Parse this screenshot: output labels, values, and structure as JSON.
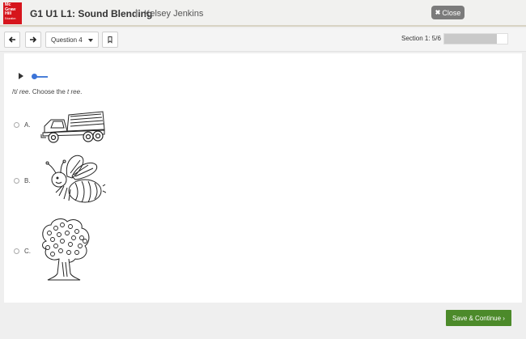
{
  "header": {
    "logo_lines": [
      "Mc",
      "Graw",
      "Hill",
      "Education"
    ],
    "title": "G1 U1 L1: Sound Blending",
    "separator": "|",
    "user_name": "Kelsey Jenkins",
    "close_label": "Close"
  },
  "toolbar": {
    "question_select": "Question 4",
    "section_label": "Section 1: 5/6",
    "progress_fraction": 0.83
  },
  "question": {
    "prompt_parts": [
      "/t/ ",
      "ree",
      ". Choose the ",
      "t ree",
      "."
    ],
    "options": [
      {
        "letter": "A.",
        "image": "dump-truck"
      },
      {
        "letter": "B.",
        "image": "bee"
      },
      {
        "letter": "C.",
        "image": "tree"
      }
    ]
  },
  "footer": {
    "save_label": "Save & Continue ›"
  },
  "colors": {
    "brand_red": "#d6151c",
    "save_green": "#4c8a2a",
    "slider_blue": "#3c74d8"
  }
}
